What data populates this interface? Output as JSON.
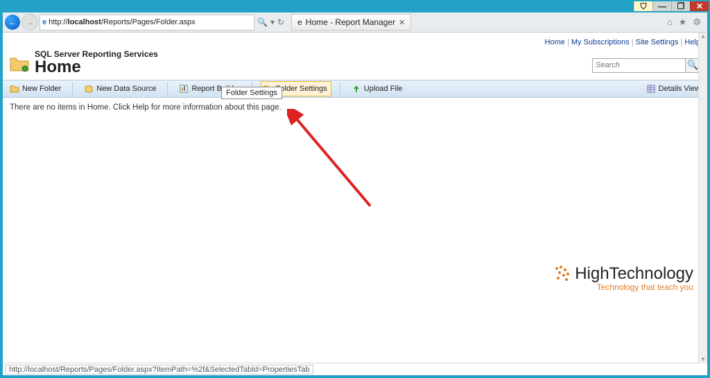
{
  "window": {
    "min": "—",
    "max": "❐",
    "close": "✕"
  },
  "browser": {
    "url_prefix": "http://",
    "url_bold": "localhost",
    "url_suffix": "/Reports/Pages/Folder.aspx",
    "tab_title": "Home - Report Manager"
  },
  "top_links": {
    "home": "Home",
    "subs": "My Subscriptions",
    "site": "Site Settings",
    "help": "Help",
    "sep": "|"
  },
  "header": {
    "subtitle": "SQL Server Reporting Services",
    "title": "Home",
    "search_placeholder": "Search"
  },
  "tooltip": "Folder Settings",
  "toolbar": {
    "new_folder": "New Folder",
    "new_ds": "New Data Source",
    "report_builder": "Report Builder",
    "folder_settings": "Folder Settings",
    "upload": "Upload File",
    "details": "Details View"
  },
  "message": "There are no items in Home. Click Help for more information about this page.",
  "watermark": {
    "title": "HighTechnology",
    "sub": "Technology that teach you"
  },
  "status": "http://localhost/Reports/Pages/Folder.aspx?ItemPath=%2f&SelectedTabId=PropertiesTab"
}
